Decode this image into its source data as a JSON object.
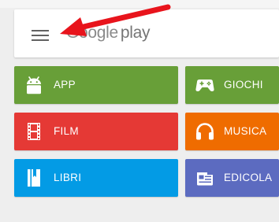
{
  "search_bar": {
    "brand_google": "Google",
    "brand_play": "play"
  },
  "categories": [
    {
      "label": "APP",
      "icon": "android-icon",
      "color": "#689f38"
    },
    {
      "label": "GIOCHI",
      "icon": "gamepad-icon",
      "color": "#689f38"
    },
    {
      "label": "FILM",
      "icon": "film-strip-icon",
      "color": "#e53935"
    },
    {
      "label": "MUSICA",
      "icon": "headphones-icon",
      "color": "#ef6c00"
    },
    {
      "label": "LIBRI",
      "icon": "book-icon",
      "color": "#039be5"
    },
    {
      "label": "EDICOLA",
      "icon": "newsstand-icon",
      "color": "#5c6bc0"
    }
  ],
  "annotation": {
    "arrow_color": "#e8141c",
    "arrow_target": "menu-icon"
  }
}
